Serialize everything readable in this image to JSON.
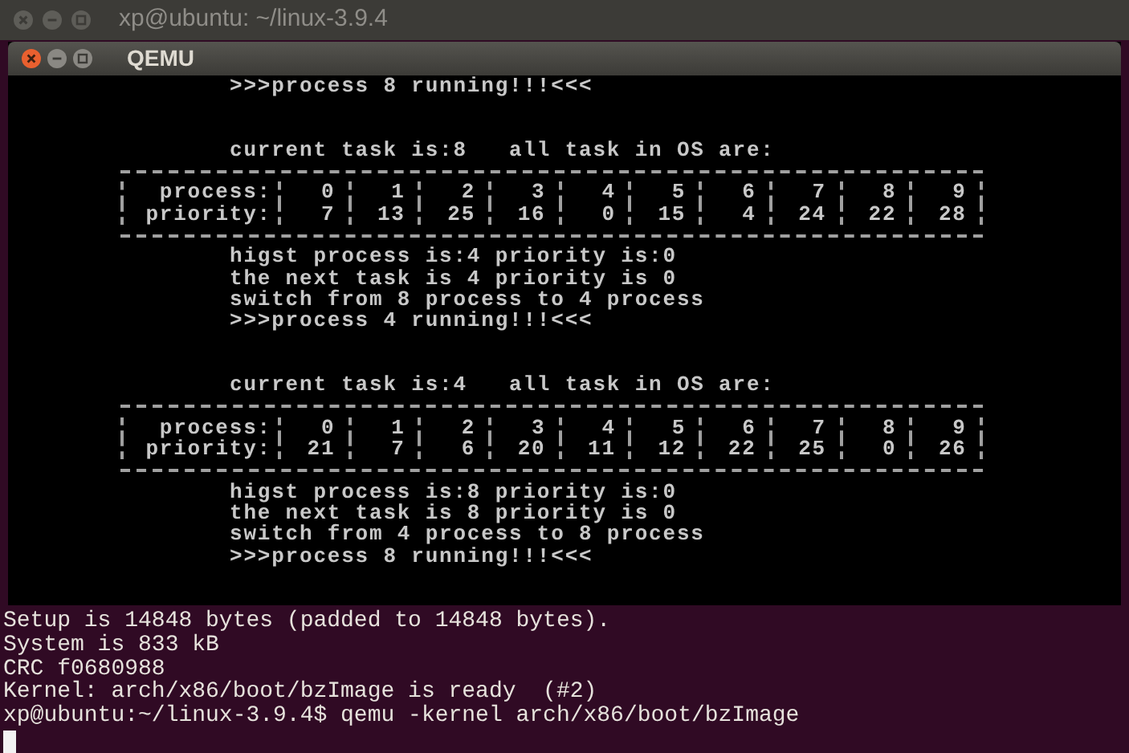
{
  "window": {
    "title": "xp@ubuntu: ~/linux-3.9.4"
  },
  "qemu": {
    "title": "QEMU",
    "lines": [
      {
        "kind": "text",
        "text": ">>>process 8 running!!!<<<"
      },
      {
        "kind": "heading",
        "text": "current task is:8   all task in OS are:"
      },
      {
        "kind": "rule"
      },
      {
        "kind": "table_row",
        "label": "process:",
        "cells": [
          "0",
          "1",
          "2",
          "3",
          "4",
          "5",
          "6",
          "7",
          "8",
          "9"
        ]
      },
      {
        "kind": "table_row",
        "label": "priority:",
        "cells": [
          "7",
          "13",
          "25",
          "16",
          "0",
          "15",
          "4",
          "24",
          "22",
          "28"
        ]
      },
      {
        "kind": "rule"
      },
      {
        "kind": "text",
        "text": "higst process is:4 priority is:0"
      },
      {
        "kind": "text",
        "text": "the next task is 4 priority is 0"
      },
      {
        "kind": "text",
        "text": "switch from 8 process to 4 process"
      },
      {
        "kind": "text",
        "text": ">>>process 4 running!!!<<<"
      },
      {
        "kind": "heading",
        "text": "current task is:4   all task in OS are:"
      },
      {
        "kind": "rule"
      },
      {
        "kind": "table_row",
        "label": "process:",
        "cells": [
          "0",
          "1",
          "2",
          "3",
          "4",
          "5",
          "6",
          "7",
          "8",
          "9"
        ]
      },
      {
        "kind": "table_row",
        "label": "priority:",
        "cells": [
          "21",
          "7",
          "6",
          "20",
          "11",
          "12",
          "22",
          "25",
          "0",
          "26"
        ]
      },
      {
        "kind": "rule"
      },
      {
        "kind": "text",
        "text": "higst process is:8 priority is:0"
      },
      {
        "kind": "text",
        "text": "the next task is 8 priority is 0"
      },
      {
        "kind": "text",
        "text": "switch from 4 process to 8 process"
      },
      {
        "kind": "text",
        "text": ">>>process 8 running!!!<<<"
      }
    ]
  },
  "terminal": {
    "lines": [
      "Setup is 14848 bytes (padded to 14848 bytes).",
      "System is 833 kB",
      "CRC f0680988",
      "Kernel: arch/x86/boot/bzImage is ready  (#2)",
      "xp@ubuntu:~/linux-3.9.4$ qemu -kernel arch/x86/boot/bzImage"
    ]
  }
}
